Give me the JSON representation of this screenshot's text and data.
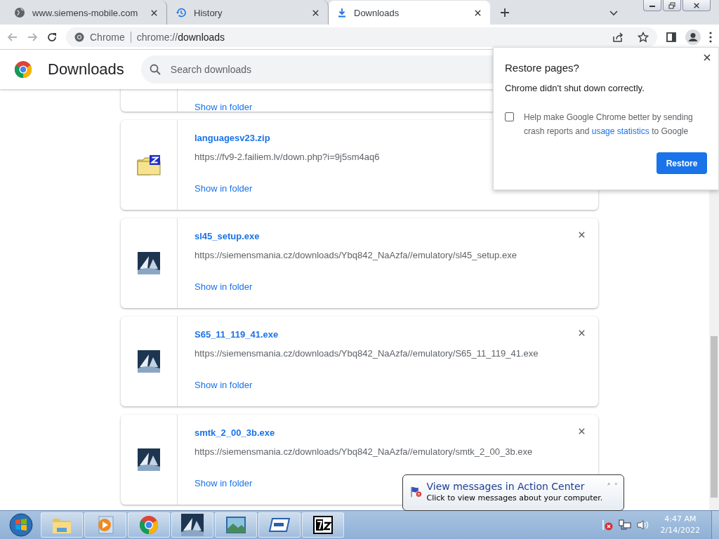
{
  "tabs": [
    {
      "title": "www.siemens-mobile.com",
      "kind": "globe",
      "selected": false
    },
    {
      "title": "History",
      "kind": "history",
      "selected": false
    },
    {
      "title": "Downloads",
      "kind": "download",
      "selected": true
    }
  ],
  "toolbar": {
    "chip": "Chrome",
    "url_prefix": "chrome://",
    "url_path": "downloads"
  },
  "page": {
    "title": "Downloads",
    "search_placeholder": "Search downloads"
  },
  "downloads": [
    {
      "kind": "partial",
      "action": "Show in folder"
    },
    {
      "kind": "zip",
      "name": "languagesv23.zip",
      "url": "https://fv9-2.failiem.lv/down.php?i=9j5sm4aq6",
      "action": "Show in folder",
      "removable": false
    },
    {
      "kind": "exe",
      "name": "sl45_setup.exe",
      "url": "https://siemensmania.cz/downloads/Ybq842_NaAzfa//emulatory/sl45_setup.exe",
      "action": "Show in folder",
      "removable": true
    },
    {
      "kind": "exe",
      "name": "S65_11_119_41.exe",
      "url": "https://siemensmania.cz/downloads/Ybq842_NaAzfa//emulatory/S65_11_119_41.exe",
      "action": "Show in folder",
      "removable": true
    },
    {
      "kind": "exe",
      "name": "smtk_2_00_3b.exe",
      "url": "https://siemensmania.cz/downloads/Ybq842_NaAzfa//emulatory/smtk_2_00_3b.exe",
      "action": "Show in folder",
      "removable": true
    }
  ],
  "restore_dialog": {
    "title": "Restore pages?",
    "message": "Chrome didn't shut down correctly.",
    "checkbox": {
      "checked": false,
      "before": "Help make Google Chrome better by sending crash reports and",
      "link": "usage statistics",
      "after": "to Google"
    },
    "button": "Restore"
  },
  "notification": {
    "title": "View messages in Action Center",
    "message": "Click to view messages about your computer."
  },
  "taskbar": {
    "items": [
      {
        "kind": "explorer"
      },
      {
        "kind": "media"
      },
      {
        "kind": "chrome"
      },
      {
        "kind": "siemens"
      },
      {
        "kind": "photo"
      },
      {
        "kind": "window"
      },
      {
        "kind": "archive"
      }
    ],
    "time": "4:47 AM",
    "date": "2/14/2022"
  }
}
